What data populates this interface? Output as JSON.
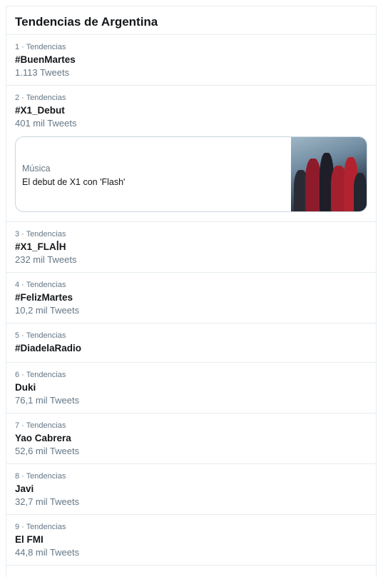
{
  "header": {
    "title": "Tendencias de Argentina"
  },
  "trends": [
    {
      "meta": "1 · Tendencias",
      "name": "#BuenMartes",
      "count": "1.113 Tweets"
    },
    {
      "meta": "2 · Tendencias",
      "name": "#X1_Debut",
      "count": "401 mil Tweets",
      "card": {
        "category": "Música",
        "title": "El debut de X1 con 'Flash'",
        "image": "x1-group-photo"
      }
    },
    {
      "meta": "3 · Tendencias",
      "name": "#X1_FLAꟾH",
      "count": "232 mil Tweets"
    },
    {
      "meta": "4 · Tendencias",
      "name": "#FelizMartes",
      "count": "10,2 mil Tweets"
    },
    {
      "meta": "5 · Tendencias",
      "name": "#DiadelaRadio"
    },
    {
      "meta": "6 · Tendencias",
      "name": "Duki",
      "count": "76,1 mil Tweets"
    },
    {
      "meta": "7 · Tendencias",
      "name": "Yao Cabrera",
      "count": "52,6 mil Tweets"
    },
    {
      "meta": "8 · Tendencias",
      "name": "Javi",
      "count": "32,7 mil Tweets"
    },
    {
      "meta": "9 · Tendencias",
      "name": "El FMI",
      "count": "44,8 mil Tweets"
    }
  ]
}
